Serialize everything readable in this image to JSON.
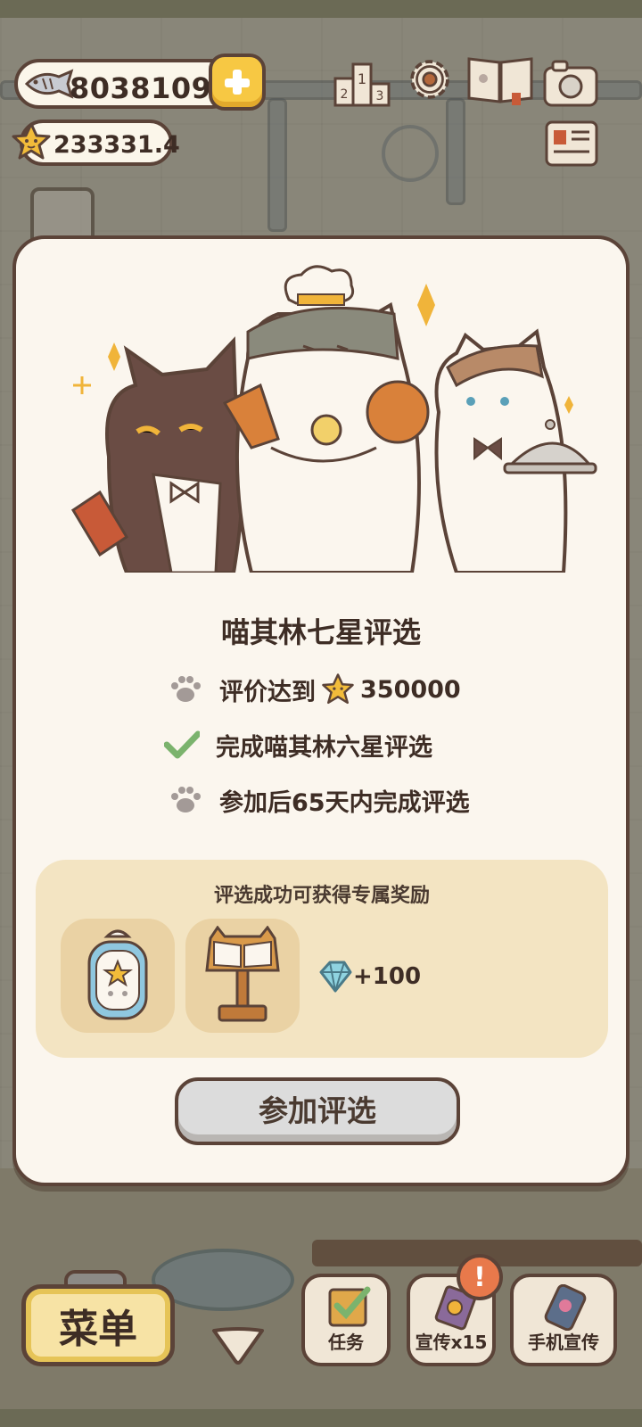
{
  "hud": {
    "fish_count": "8038109",
    "star_count": "233331.4",
    "icons": [
      "fish-icon",
      "add-currency-button",
      "leaderboard-icon",
      "settings-gear-icon",
      "recipe-book-icon",
      "camera-icon",
      "newspaper-icon",
      "star-icon"
    ]
  },
  "modal": {
    "title": "喵其林七星评选",
    "requirements": [
      {
        "status": "pending",
        "text_before": "评价达到",
        "value": "350000",
        "icon": "star-icon"
      },
      {
        "status": "done",
        "text": "完成喵其林六星评选"
      },
      {
        "status": "pending",
        "text": "参加后65天内完成评选"
      }
    ],
    "reward": {
      "title": "评选成功可获得专属奖励",
      "items": [
        "star-badge-frame",
        "recipe-stand"
      ],
      "gem_amount": "+100"
    },
    "join_button": "参加评选"
  },
  "bottom_bar": {
    "menu_label": "菜单",
    "task_label": "任务",
    "promo_label": "宣传x15",
    "phone_promo_label": "手机宣传",
    "alert_badge": "!"
  },
  "colors": {
    "outline": "#5b4338",
    "modal_bg": "#fbf6ee",
    "reward_bg": "#f3e4c2",
    "gold": "#f7c843",
    "button_gray": "#dcdcdc",
    "check_green": "#7bb36d"
  }
}
